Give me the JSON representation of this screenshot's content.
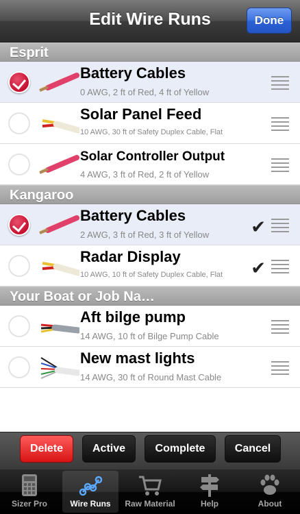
{
  "nav": {
    "title": "Edit Wire Runs",
    "done_label": "Done"
  },
  "sections": [
    {
      "title": "Esprit"
    },
    {
      "title": "Kangaroo"
    },
    {
      "title": "Your Boat or Job Na…"
    }
  ],
  "rows": [
    {
      "title": "Battery Cables",
      "subtitle": "0 AWG, 2 ft of Red, 4 ft of Yellow",
      "checked": true,
      "ticked": false
    },
    {
      "title": "Solar Panel Feed",
      "subtitle": "10 AWG, 30 ft of Safety Duplex Cable, Flat",
      "checked": false,
      "ticked": false
    },
    {
      "title": "Solar Controller Output",
      "subtitle": "4 AWG, 3 ft of Red, 2 ft of Yellow",
      "checked": false,
      "ticked": false
    },
    {
      "title": "Battery Cables",
      "subtitle": "2 AWG, 3 ft of Red, 3 ft of Yellow",
      "checked": true,
      "ticked": true
    },
    {
      "title": "Radar Display",
      "subtitle": "10 AWG, 10 ft of Safety Duplex Cable, Flat",
      "checked": false,
      "ticked": true
    },
    {
      "title": "Aft bilge pump",
      "subtitle": "14 AWG, 10 ft of Bilge Pump Cable",
      "checked": false,
      "ticked": false
    },
    {
      "title": "New mast lights",
      "subtitle": "14 AWG, 30 ft of Round Mast Cable",
      "checked": false,
      "ticked": false
    }
  ],
  "toolbar": {
    "delete": "Delete",
    "active": "Active",
    "complete": "Complete",
    "cancel": "Cancel"
  },
  "tabs": [
    {
      "label": "Sizer Pro",
      "icon": "calculator-icon"
    },
    {
      "label": "Wire Runs",
      "icon": "wire-runs-icon"
    },
    {
      "label": "Raw Material",
      "icon": "cart-icon"
    },
    {
      "label": "Help",
      "icon": "signpost-icon"
    },
    {
      "label": "About",
      "icon": "paw-icon"
    }
  ],
  "colors": {
    "accent": "#3c73e0",
    "check": "#c5102f",
    "delete": "#d61414"
  }
}
